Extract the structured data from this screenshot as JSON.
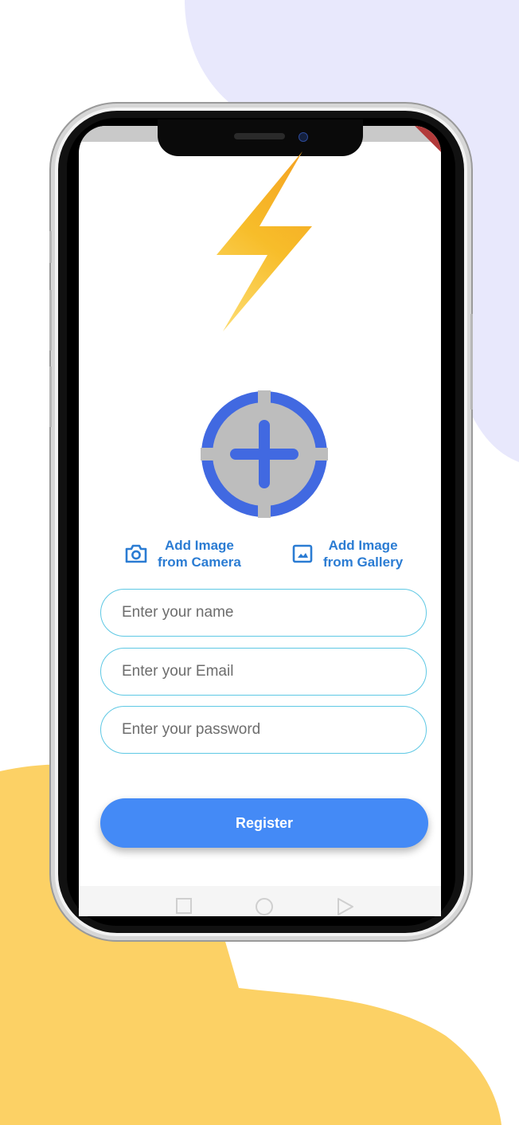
{
  "colors": {
    "accent": "#448af6",
    "link_blue": "#2b7cd3",
    "field_border": "#5ec8e4",
    "avatar_ring": "#4169e1",
    "avatar_fill": "#bdbdbd",
    "bg_blob_lavender": "#e8e8fc",
    "bg_blob_yellow": "#fcd165",
    "bolt_orange": "#f5a623",
    "bolt_yellow": "#fcd34d"
  },
  "logo": {
    "icon": "lightning-bolt-icon"
  },
  "avatar": {
    "icon": "add-photo-crosshair-icon"
  },
  "image_options": {
    "camera": {
      "icon": "camera-icon",
      "line1": "Add Image",
      "line2": "from Camera"
    },
    "gallery": {
      "icon": "gallery-image-icon",
      "line1": "Add Image",
      "line2": "from Gallery"
    }
  },
  "form": {
    "name_placeholder": "Enter your name",
    "email_placeholder": "Enter your Email",
    "password_placeholder": "Enter your password",
    "register_label": "Register"
  },
  "nav": {
    "recents_icon": "square-icon",
    "home_icon": "circle-icon",
    "back_icon": "triangle-icon"
  }
}
